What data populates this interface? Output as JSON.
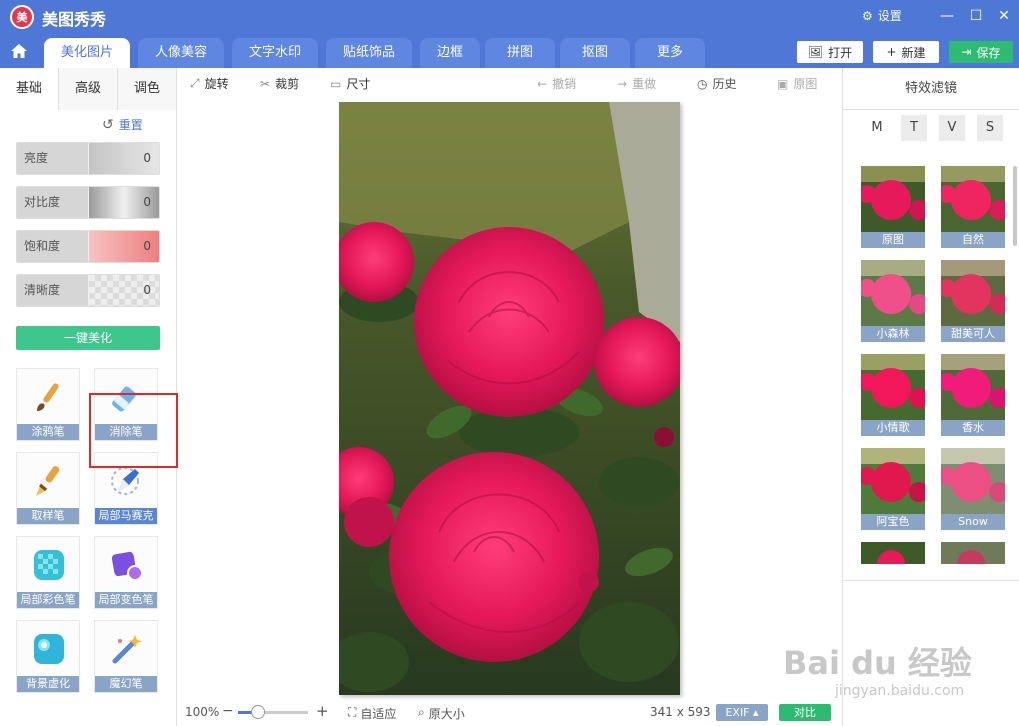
{
  "app": {
    "title": "美图秀秀",
    "logo_text": "美",
    "settings_label": "设置"
  },
  "window": {
    "minimize": "—",
    "maximize": "☐",
    "close": "✕"
  },
  "tabs": [
    "美化图片",
    "人像美容",
    "文字水印",
    "贴纸饰品",
    "边框",
    "拼图",
    "抠图",
    "更多"
  ],
  "active_tab": "美化图片",
  "top_buttons": {
    "open": "打开",
    "new": "新建",
    "save": "保存"
  },
  "left_panel": {
    "subtabs": [
      "基础",
      "高级",
      "调色"
    ],
    "reset_label": "重置",
    "sliders": [
      {
        "label": "亮度",
        "value": "0",
        "color": "#cfcfcf"
      },
      {
        "label": "对比度",
        "value": "0",
        "color": "#bdbdbd"
      },
      {
        "label": "饱和度",
        "value": "0",
        "color": "#f08c8c"
      },
      {
        "label": "清晰度",
        "value": "0",
        "color": "#e8e8e8"
      }
    ],
    "one_click_beauty": "一键美化",
    "tools": [
      "涂鸦笔",
      "消除笔",
      "取样笔",
      "局部马赛克",
      "局部彩色笔",
      "局部变色笔",
      "背景虚化",
      "魔幻笔"
    ]
  },
  "canvas_toolbar": {
    "rotate": "旋转",
    "crop": "裁剪",
    "size": "尺寸",
    "undo": "撤销",
    "redo": "重做",
    "history": "历史",
    "original": "原图"
  },
  "status_bar": {
    "zoom": "100%",
    "zoom_level": 0.25,
    "fit": "自适应",
    "actual_size": "原大小",
    "dimensions": "341 x 593",
    "exif": "EXIF",
    "compare": "对比"
  },
  "right_panel": {
    "title": "特效滤镜",
    "categories": [
      "M",
      "T",
      "V",
      "S"
    ],
    "filters": [
      "原图",
      "自然",
      "小森林",
      "甜美可人",
      "小情歌",
      "香水",
      "阿宝色",
      "Snow"
    ]
  },
  "watermark": {
    "text": "Bai du 经验",
    "sub": "jingyan.baidu.com"
  },
  "colors": {
    "accent": "#4f77d6",
    "green": "#2dbb72",
    "caption": "#8aa4c8",
    "highlight": "#e02a2a",
    "rose": "#e6195a"
  }
}
